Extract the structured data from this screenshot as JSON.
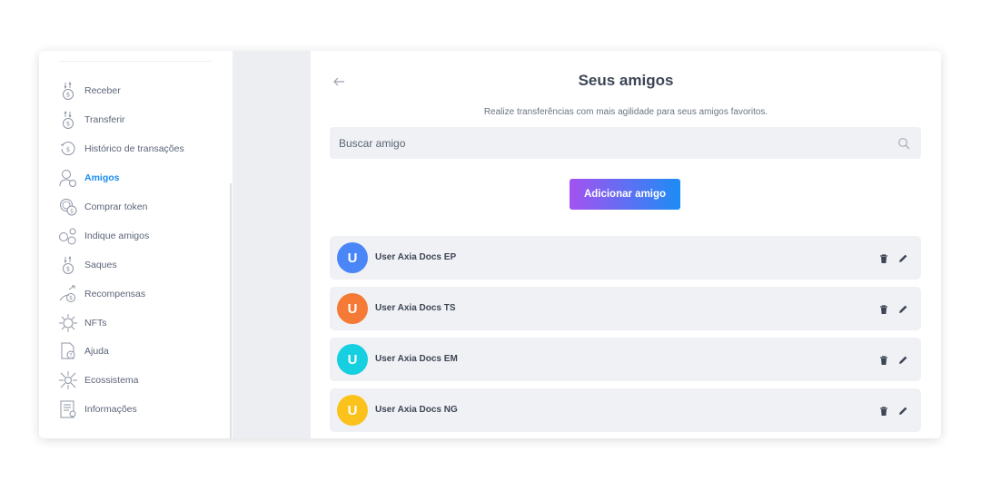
{
  "sidebar": {
    "items": [
      {
        "label": "Receber",
        "icon": "coin-receive-icon",
        "active": false
      },
      {
        "label": "Transferir",
        "icon": "coin-transfer-icon",
        "active": false
      },
      {
        "label": "Histórico de transações",
        "icon": "history-coin-icon",
        "active": false
      },
      {
        "label": "Amigos",
        "icon": "friends-icon",
        "active": true
      },
      {
        "label": "Comprar token",
        "icon": "buy-token-icon",
        "active": false
      },
      {
        "label": "Indique amigos",
        "icon": "refer-friends-icon",
        "active": false
      },
      {
        "label": "Saques",
        "icon": "withdraw-icon",
        "active": false
      },
      {
        "label": "Recompensas",
        "icon": "rewards-icon",
        "active": false
      },
      {
        "label": "NFTs",
        "icon": "nft-icon",
        "active": false
      },
      {
        "label": "Ajuda",
        "icon": "help-icon",
        "active": false
      },
      {
        "label": "Ecossistema",
        "icon": "ecosystem-icon",
        "active": false
      },
      {
        "label": "Informações",
        "icon": "info-doc-icon",
        "active": false
      }
    ]
  },
  "main": {
    "title": "Seus amigos",
    "subtitle": "Realize transferências com mais agilidade para seus amigos favoritos.",
    "search": {
      "placeholder": "Buscar amigo",
      "value": ""
    },
    "add_button_label": "Adicionar amigo",
    "friends": [
      {
        "initial": "U",
        "name": "User Axia Docs EP",
        "color": "#4a86f7"
      },
      {
        "initial": "U",
        "name": "User Axia Docs TS",
        "color": "#f47a35"
      },
      {
        "initial": "U",
        "name": "User Axia Docs EM",
        "color": "#16cfe0"
      },
      {
        "initial": "U",
        "name": "User Axia Docs NG",
        "color": "#fbc21c"
      }
    ]
  },
  "colors": {
    "accent": "#1e8cf0",
    "button_gradient_start": "#a452f0",
    "button_gradient_end": "#1d8cf5",
    "text_dark": "#3d4656",
    "row_background": "#f0f1f4"
  }
}
